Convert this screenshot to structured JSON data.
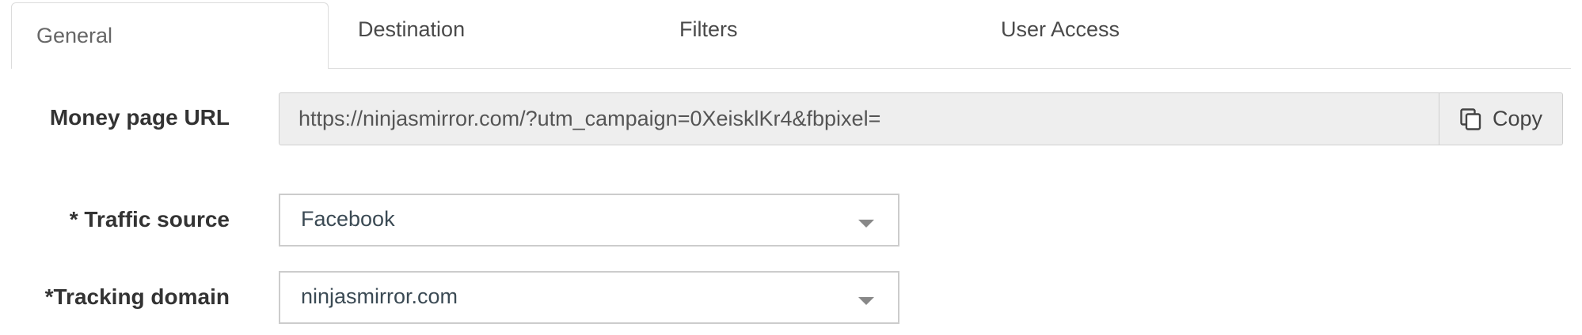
{
  "tabs": [
    {
      "label": "General",
      "active": true
    },
    {
      "label": "Destination",
      "active": false
    },
    {
      "label": "Filters",
      "active": false
    },
    {
      "label": "User Access",
      "active": false
    }
  ],
  "money_page": {
    "label": "Money page URL",
    "value": "https://ninjasmirror.com/?utm_campaign=0XeisklKr4&fbpixel=",
    "copy_label": "Copy",
    "copy_icon": "copy-icon"
  },
  "traffic_source": {
    "label": "* Traffic source",
    "value": "Facebook",
    "icon": "chevron-down-icon"
  },
  "tracking_domain": {
    "label": "*Tracking domain",
    "value": "ninjasmirror.com",
    "icon": "chevron-down-icon"
  }
}
